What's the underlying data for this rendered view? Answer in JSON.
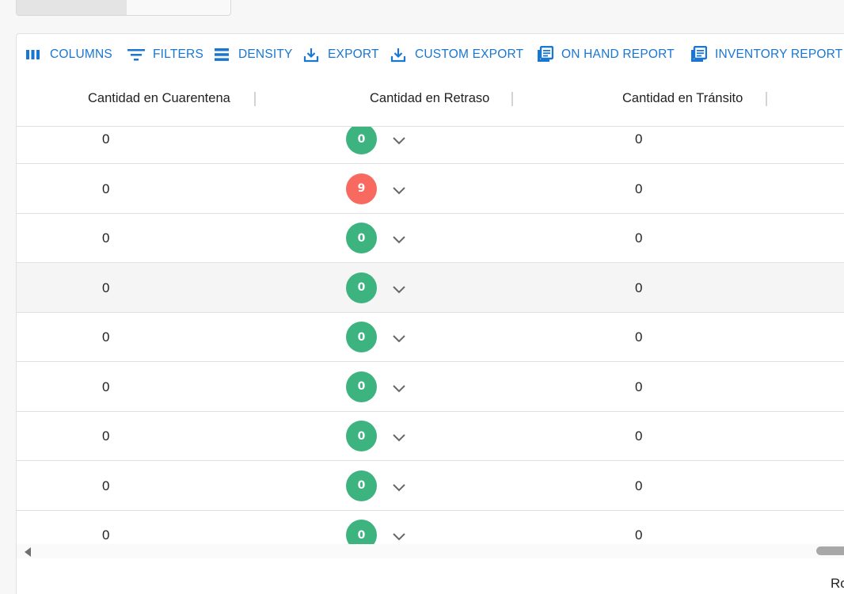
{
  "toolbar": {
    "columns": "COLUMNS",
    "filters": "FILTERS",
    "density": "DENSITY",
    "export": "EXPORT",
    "custom_export": "CUSTOM EXPORT",
    "on_hand_report": "ON HAND REPORT",
    "inventory_report": "INVENTORY REPORT"
  },
  "headers": {
    "quarantine": "Cantidad en Cuarentena",
    "delay": "Cantidad en Retraso",
    "transit": "Cantidad en Tránsito"
  },
  "colors": {
    "accent": "#1976d2",
    "badge_ok": "#3db37f",
    "badge_alert": "#f86a5f"
  },
  "rows": [
    {
      "quarantine": "0",
      "delay": "0",
      "transit": "0",
      "status": "ok"
    },
    {
      "quarantine": "0",
      "delay": "9",
      "transit": "0",
      "status": "alert"
    },
    {
      "quarantine": "0",
      "delay": "0",
      "transit": "0",
      "status": "ok"
    },
    {
      "quarantine": "0",
      "delay": "0",
      "transit": "0",
      "status": "ok",
      "hovered": true
    },
    {
      "quarantine": "0",
      "delay": "0",
      "transit": "0",
      "status": "ok"
    },
    {
      "quarantine": "0",
      "delay": "0",
      "transit": "0",
      "status": "ok"
    },
    {
      "quarantine": "0",
      "delay": "0",
      "transit": "0",
      "status": "ok"
    },
    {
      "quarantine": "0",
      "delay": "0",
      "transit": "0",
      "status": "ok"
    },
    {
      "quarantine": "0",
      "delay": "0",
      "transit": "0",
      "status": "ok"
    }
  ],
  "footer": {
    "rows_label_partial": "Ro"
  }
}
